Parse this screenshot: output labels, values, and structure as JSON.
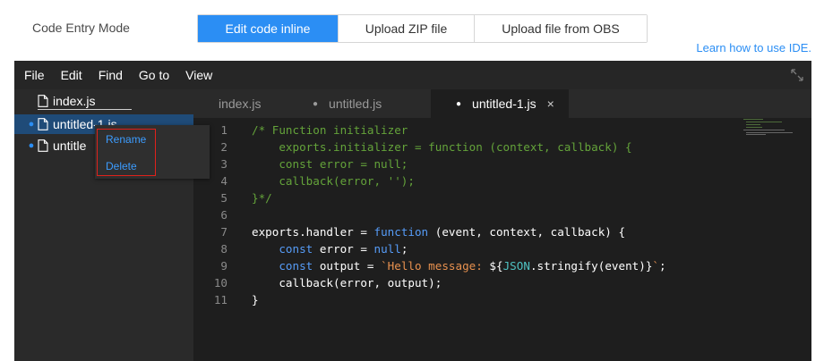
{
  "header": {
    "mode_label": "Code Entry Mode",
    "modes": [
      {
        "label": "Edit code inline",
        "active": true
      },
      {
        "label": "Upload ZIP file",
        "active": false
      },
      {
        "label": "Upload file from OBS",
        "active": false
      }
    ],
    "learn_link": "Learn how to use IDE."
  },
  "menu": {
    "items": [
      "File",
      "Edit",
      "Find",
      "Go to",
      "View"
    ]
  },
  "sidebar": {
    "files": [
      {
        "name": "index.js",
        "modified": false,
        "selected": false
      },
      {
        "name": "untitled-1.js",
        "modified": true,
        "selected": true
      },
      {
        "name": "untitled.js",
        "modified": true,
        "selected": false
      }
    ],
    "partial_names": [
      "untitled-1.js",
      "untitle"
    ]
  },
  "context_menu": {
    "rename": "Rename",
    "delete": "Delete"
  },
  "tabs": [
    {
      "label": "index.js",
      "modified": false,
      "active": false
    },
    {
      "label": "untitled.js",
      "modified": true,
      "active": false
    },
    {
      "label": "untitled-1.js",
      "modified": true,
      "active": true,
      "close": "×"
    }
  ],
  "editor": {
    "line_numbers": [
      "1",
      "2",
      "3",
      "4",
      "5",
      "6",
      "7",
      "8",
      "9",
      "10",
      "11"
    ],
    "lines": [
      [
        {
          "t": "/* Function initializer",
          "c": "comment"
        }
      ],
      [
        {
          "t": "    exports.initializer = function (context, callback) {",
          "c": "comment"
        }
      ],
      [
        {
          "t": "    const error = null;",
          "c": "comment"
        }
      ],
      [
        {
          "t": "    callback(error, '');",
          "c": "comment"
        }
      ],
      [
        {
          "t": "}*/",
          "c": "comment"
        }
      ],
      [],
      [
        {
          "t": "exports.handler = ",
          "c": "plain"
        },
        {
          "t": "function",
          "c": "kw"
        },
        {
          "t": " (event, context, callback) {",
          "c": "plain"
        }
      ],
      [
        {
          "t": "    ",
          "c": "plain"
        },
        {
          "t": "const",
          "c": "kw"
        },
        {
          "t": " error = ",
          "c": "plain"
        },
        {
          "t": "null",
          "c": "kw"
        },
        {
          "t": ";",
          "c": "plain"
        }
      ],
      [
        {
          "t": "    ",
          "c": "plain"
        },
        {
          "t": "const",
          "c": "kw"
        },
        {
          "t": " output = ",
          "c": "plain"
        },
        {
          "t": "`Hello message: ",
          "c": "str"
        },
        {
          "t": "${",
          "c": "plain"
        },
        {
          "t": "JSON",
          "c": "fn"
        },
        {
          "t": ".stringify(event)}",
          "c": "plain"
        },
        {
          "t": "`",
          "c": "str"
        },
        {
          "t": ";",
          "c": "plain"
        }
      ],
      [
        {
          "t": "    callback(error, output);",
          "c": "plain"
        }
      ],
      [
        {
          "t": "}",
          "c": "plain"
        }
      ]
    ]
  },
  "colors": {
    "accent": "#2b8ef4",
    "ide_bg": "#272727",
    "editor_bg": "#1e1e1e",
    "selected_row": "#1f4b78",
    "highlight_border": "#e0211b"
  }
}
